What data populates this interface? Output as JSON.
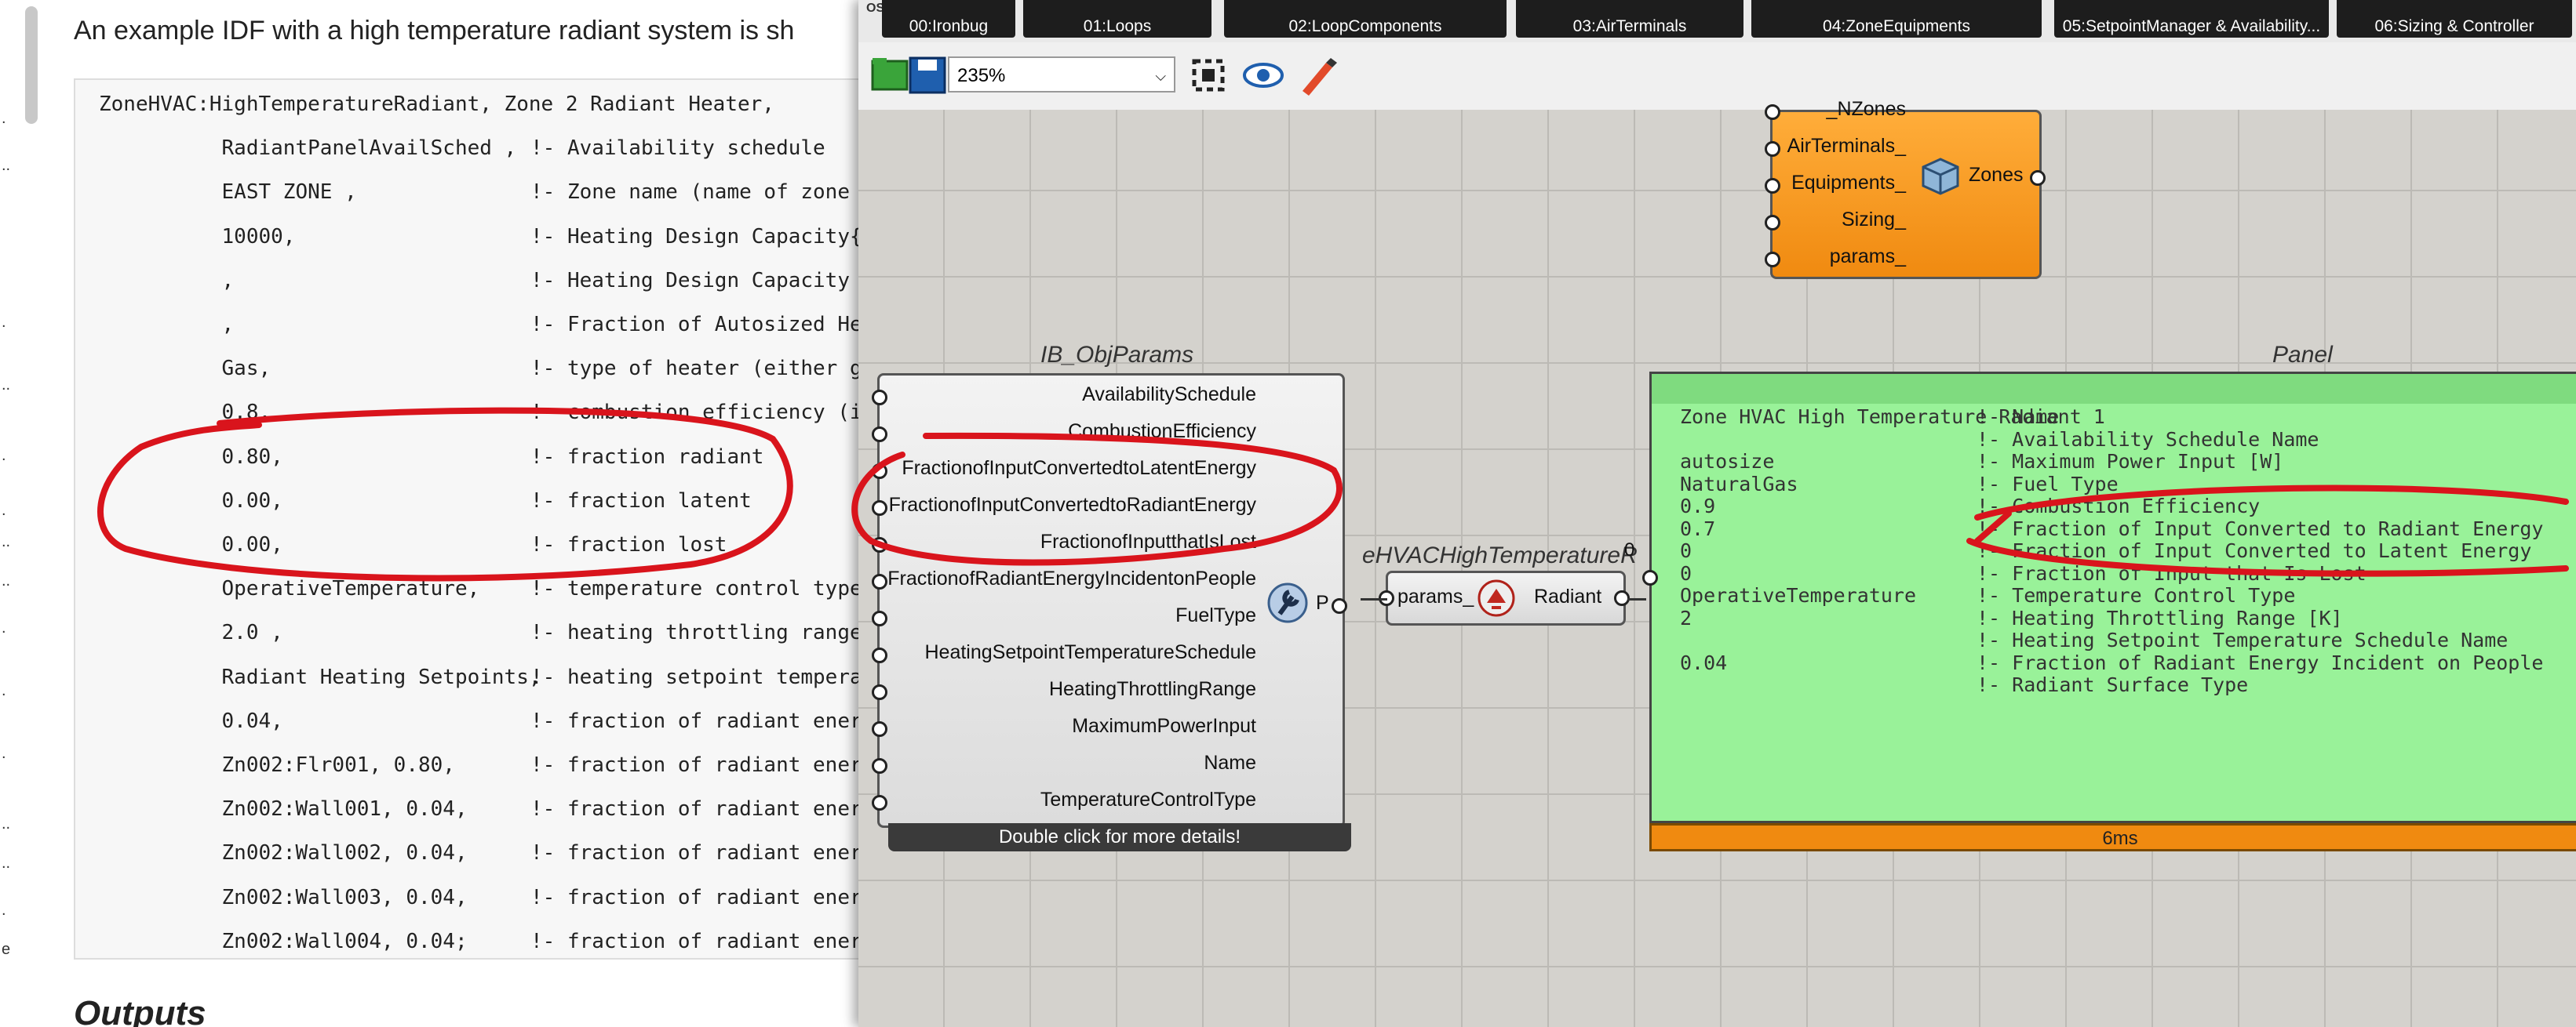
{
  "doc": {
    "intro": "An example IDF with a high temperature radiant system is sh",
    "code_lines": [
      {
        "value": "ZoneHVAC:HighTemperatureRadiant, Zone 2 Radiant Heater,",
        "comment": ""
      },
      {
        "value": "          RadiantPanelAvailSched ,",
        "comment": "!- Availability schedule"
      },
      {
        "value": "          EAST ZONE ,",
        "comment": "!- Zone name (name of zone sy"
      },
      {
        "value": "          10000,",
        "comment": "!- Heating Design Capacity{ W"
      },
      {
        "value": "          ,",
        "comment": "!- Heating Design Capacity Pe"
      },
      {
        "value": "          ,",
        "comment": "!- Fraction of Autosized Heat"
      },
      {
        "value": "          Gas,",
        "comment": "!- type of heater (either gas"
      },
      {
        "value": "          0.8,",
        "comment": "!- combustion efficiency (ign"
      },
      {
        "value": "          0.80,",
        "comment": "!- fraction radiant"
      },
      {
        "value": "          0.00,",
        "comment": "!- fraction latent"
      },
      {
        "value": "          0.00,",
        "comment": "!- fraction lost"
      },
      {
        "value": "          OperativeTemperature,",
        "comment": "!- temperature control type ("
      },
      {
        "value": "          2.0 ,",
        "comment": "!- heating throttling range ("
      },
      {
        "value": "          Radiant Heating Setpoints,",
        "comment": "!- heating setpoint temperatu"
      },
      {
        "value": "          0.04,",
        "comment": "!- fraction of radiant energy"
      },
      {
        "value": "          Zn002:Flr001, 0.80,",
        "comment": "!- fraction of radiant energy"
      },
      {
        "value": "          Zn002:Wall001, 0.04,",
        "comment": "!- fraction of radiant energy"
      },
      {
        "value": "          Zn002:Wall002, 0.04,",
        "comment": "!- fraction of radiant energy"
      },
      {
        "value": "          Zn002:Wall003, 0.04,",
        "comment": "!- fraction of radiant energy"
      },
      {
        "value": "          Zn002:Wall004, 0.04;",
        "comment": "!- fraction of radiant energy"
      }
    ],
    "outputs_heading": "Outputs",
    "side_marks": [
      ".",
      "..",
      ".",
      "..",
      ".",
      ".",
      "..",
      "..",
      ".",
      ".",
      ".",
      "..",
      "..",
      ".",
      "e"
    ]
  },
  "app": {
    "tabs": [
      "00:Ironbug",
      "01:Loops",
      "02:LoopComponents",
      "03:AirTerminals",
      "04:ZoneEquipments",
      "05:SetpointManager & Availability...",
      "06:Sizing & Controller"
    ],
    "osm_label": "OSM",
    "zoom_value": "235%",
    "objparams": {
      "title": "IB_ObjParams",
      "inputs": [
        "AvailabilitySchedule",
        "CombustionEfficiency",
        "FractionofInputConvertedtoLatentEnergy",
        "FractionofInputConvertedtoRadiantEnergy",
        "FractionofInputthatIsLost",
        "FractionofRadiantEnergyIncidentonPeople",
        "FuelType",
        "HeatingSetpointTemperatureSchedule",
        "HeatingThrottlingRange",
        "MaximumPowerInput",
        "Name",
        "TemperatureControlType"
      ],
      "output": "P",
      "tip": "Double click for more details!"
    },
    "zones": {
      "inputs": [
        "_NZones",
        "AirTerminals_",
        "Equipments_",
        "Sizing_",
        "params_"
      ],
      "output": "Zones"
    },
    "hvac": {
      "title": "eHVACHighTemperatureR",
      "input": "params_",
      "output": "Radiant"
    },
    "panel": {
      "title": "Panel",
      "index": "0",
      "lines": [
        {
          "value": "Zone HVAC High Temperature Radiant 1",
          "comment": "!- Name"
        },
        {
          "value": "",
          "comment": "!- Availability Schedule Name"
        },
        {
          "value": "autosize",
          "comment": "!- Maximum Power Input [W]"
        },
        {
          "value": "NaturalGas",
          "comment": "!- Fuel Type"
        },
        {
          "value": "0.9",
          "comment": "!- Combustion Efficiency"
        },
        {
          "value": "0.7",
          "comment": "!- Fraction of Input Converted to Radiant Energy"
        },
        {
          "value": "0",
          "comment": "!- Fraction of Input Converted to Latent Energy"
        },
        {
          "value": "0",
          "comment": "!- Fraction of Input that Is Lost"
        },
        {
          "value": "OperativeTemperature",
          "comment": "!- Temperature Control Type"
        },
        {
          "value": "2",
          "comment": "!- Heating Throttling Range [K]"
        },
        {
          "value": "",
          "comment": "!- Heating Setpoint Temperature Schedule Name"
        },
        {
          "value": "0.04",
          "comment": "!- Fraction of Radiant Energy Incident on People"
        },
        {
          "value": "",
          "comment": "!- Radiant Surface Type"
        }
      ],
      "timing": "6ms"
    }
  },
  "colors": {
    "annotation": "#d9141c",
    "panel_bg": "#99f299",
    "orange": "#f08a10"
  }
}
